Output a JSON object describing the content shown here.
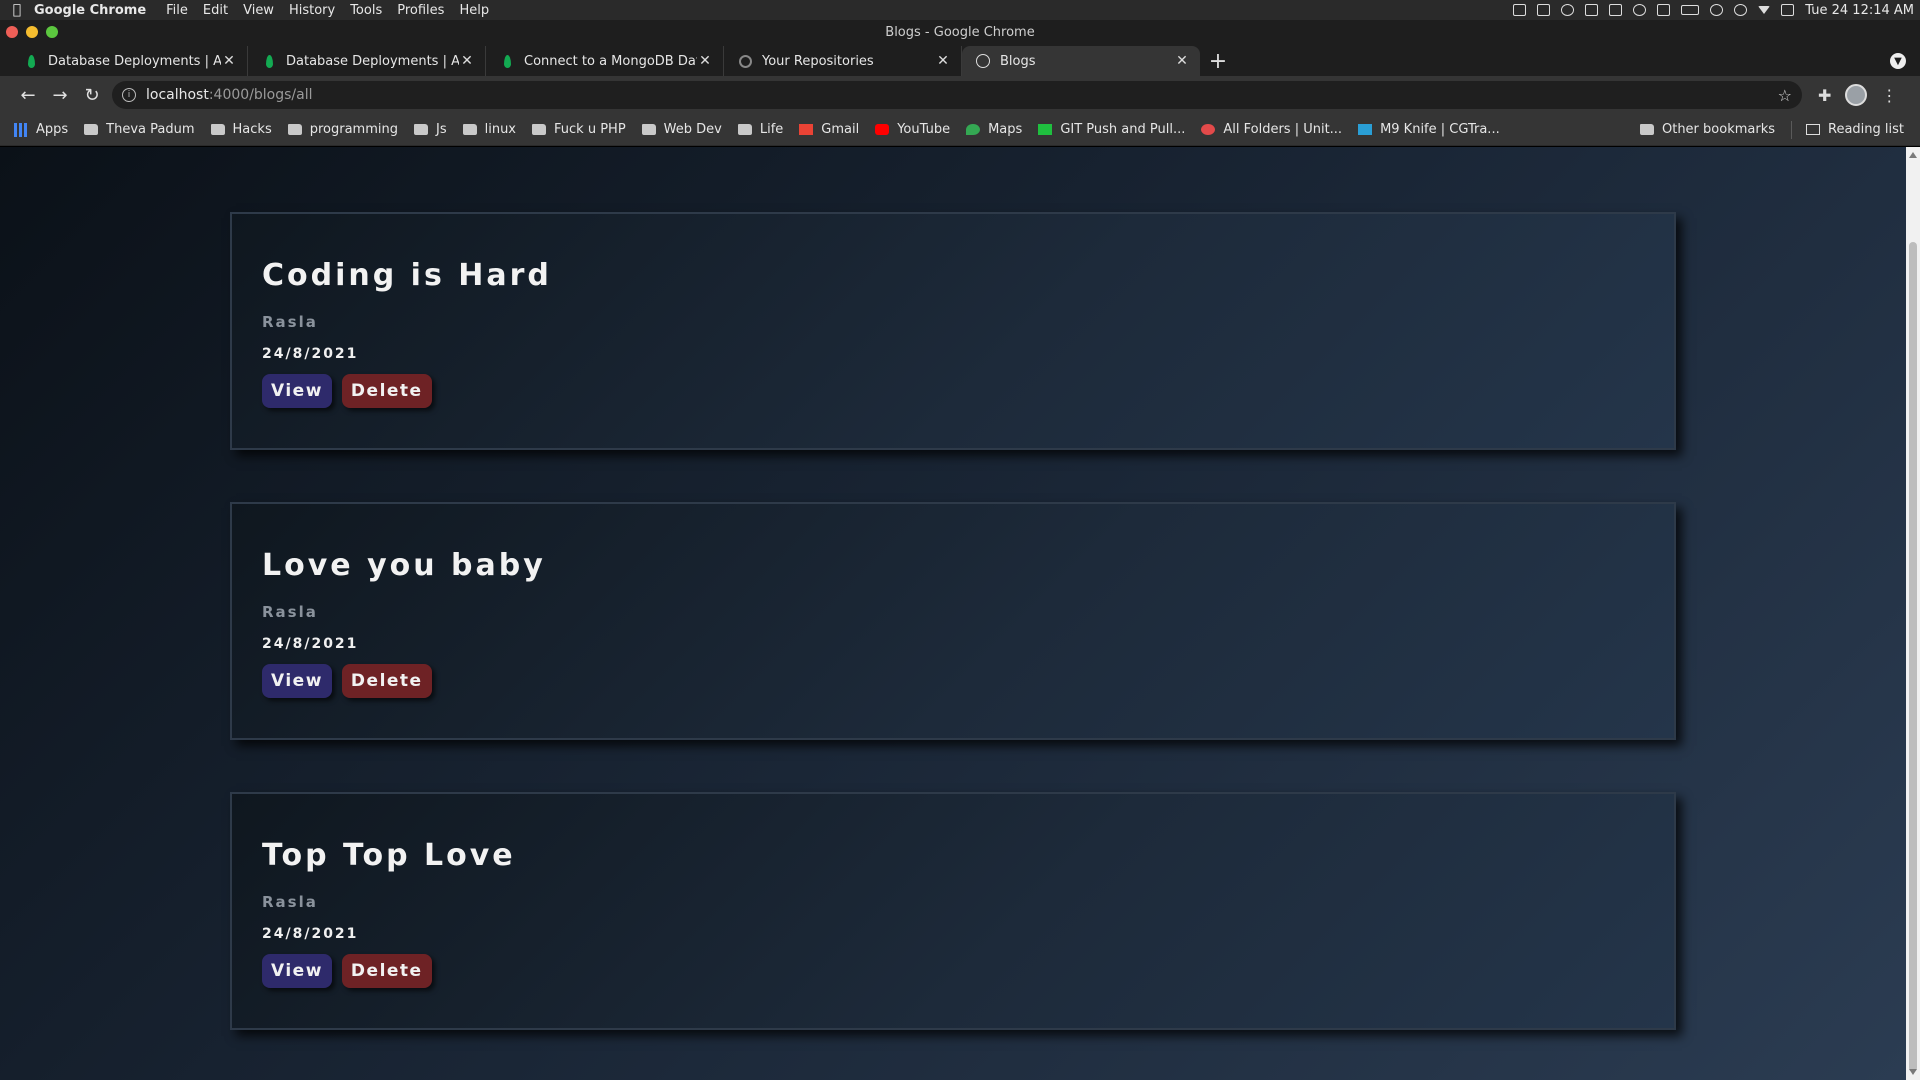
{
  "menubar": {
    "app_name": "Google Chrome",
    "menus": [
      "File",
      "Edit",
      "View",
      "History",
      "Tools",
      "Profiles",
      "Help"
    ],
    "clock": "Tue 24  12:14 AM"
  },
  "window": {
    "title": "Blogs - Google Chrome"
  },
  "tabs": [
    {
      "title": "Database Deployments | Atla",
      "icon": "mongodb-leaf-icon"
    },
    {
      "title": "Database Deployments | Atla",
      "icon": "mongodb-leaf-icon"
    },
    {
      "title": "Connect to a MongoDB Datal",
      "icon": "mongodb-leaf-icon"
    },
    {
      "title": "Your Repositories",
      "icon": "github-icon"
    },
    {
      "title": "Blogs",
      "icon": "globe-icon",
      "active": true
    }
  ],
  "address_bar": {
    "host": "localhost",
    "path": ":4000/blogs/all"
  },
  "bookmarks": {
    "items": [
      {
        "label": "Apps",
        "icon": "apps-grid-icon"
      },
      {
        "label": "Theva Padum",
        "icon": "folder-icon"
      },
      {
        "label": "Hacks",
        "icon": "folder-icon"
      },
      {
        "label": "programming",
        "icon": "folder-icon"
      },
      {
        "label": "Js",
        "icon": "folder-icon"
      },
      {
        "label": "linux",
        "icon": "folder-icon"
      },
      {
        "label": "Fuck u PHP",
        "icon": "folder-icon"
      },
      {
        "label": "Web Dev",
        "icon": "folder-icon"
      },
      {
        "label": "Life",
        "icon": "folder-icon"
      },
      {
        "label": "Gmail",
        "icon": "gmail-icon"
      },
      {
        "label": "YouTube",
        "icon": "youtube-icon"
      },
      {
        "label": "Maps",
        "icon": "maps-icon"
      },
      {
        "label": "GIT Push and Pull...",
        "icon": "git-icon"
      },
      {
        "label": "All Folders | Unit...",
        "icon": "unit-icon"
      },
      {
        "label": "M9 Knife | CGTra...",
        "icon": "cgtrader-icon"
      }
    ],
    "other_label": "Other bookmarks",
    "reading_list_label": "Reading list"
  },
  "blogs": [
    {
      "title": "Coding is Hard",
      "author": "Rasla",
      "date": "24/8/2021",
      "view_label": "View",
      "delete_label": "Delete"
    },
    {
      "title": "Love you baby",
      "author": "Rasla",
      "date": "24/8/2021",
      "view_label": "View",
      "delete_label": "Delete"
    },
    {
      "title": "Top Top Love",
      "author": "Rasla",
      "date": "24/8/2021",
      "view_label": "View",
      "delete_label": "Delete"
    }
  ],
  "colors": {
    "view_button": "#2e2a6b",
    "delete_button": "#6e2225",
    "page_bg_start": "#0b1118",
    "page_bg_end": "#2b3c52"
  }
}
